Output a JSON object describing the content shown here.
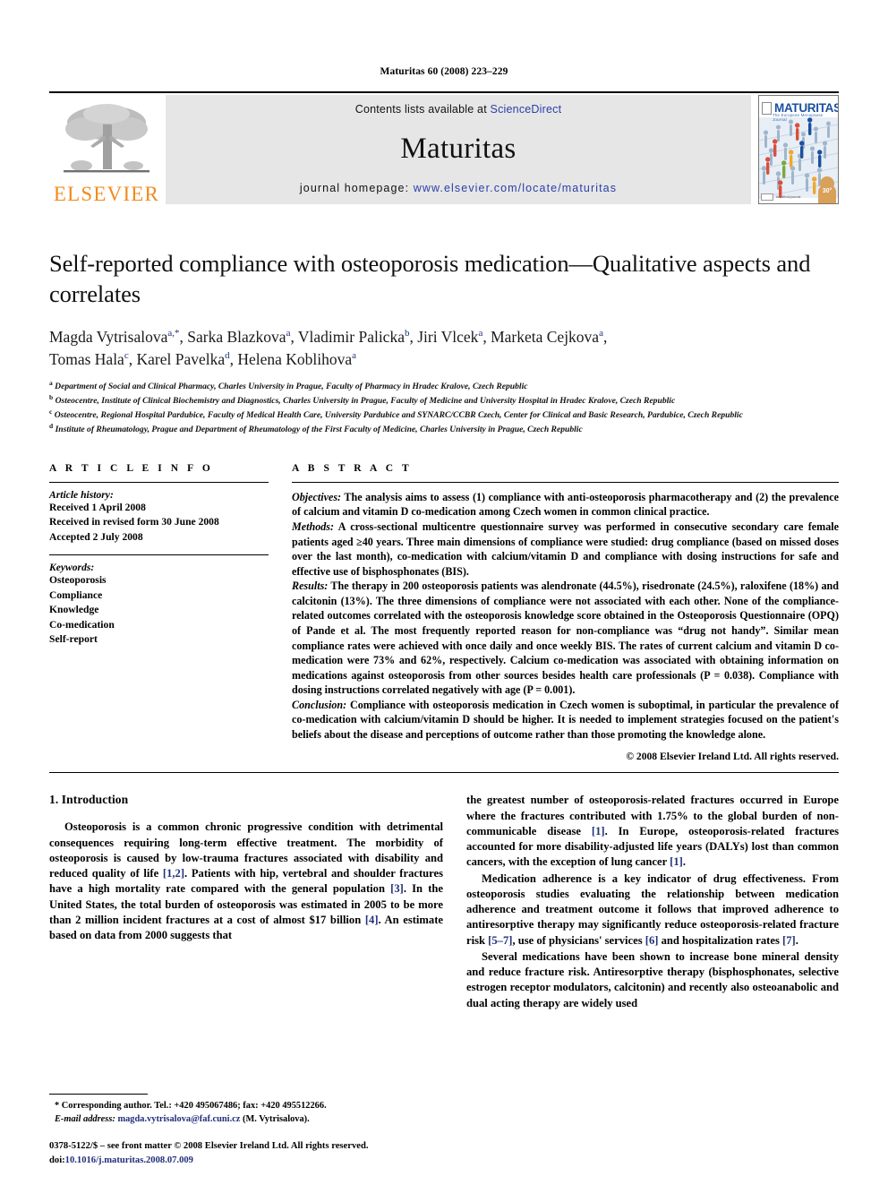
{
  "running_head": "Maturitas 60 (2008) 223–229",
  "banner": {
    "publisher_logo_text": "ELSEVIER",
    "contents_prefix": "Contents lists available at ",
    "contents_link": "ScienceDirect",
    "journal_name": "Maturitas",
    "homepage_prefix": "journal homepage: ",
    "homepage_url": "www.elsevier.com/locate/maturitas",
    "cover": {
      "wordmark": "MATURITAS",
      "subtitle": "The European Menopause Journal",
      "badge": "30°",
      "footer_text": "An official journal"
    },
    "colors": {
      "elsevier_orange": "#F08B1D",
      "link_blue": "#2b40a6",
      "banner_grey": "#e6e6e6"
    }
  },
  "article": {
    "title": "Self-reported compliance with osteoporosis medication—Qualitative aspects and correlates",
    "authors_line1": "Magda Vytrisalova",
    "authors_html": "Magda Vytrisalova<sup>a,*</sup>, Sarka Blazkova<sup>a</sup>, Vladimir Palicka<sup>b</sup>, Jiri Vlcek<sup>a</sup>, Marketa Cejkova<sup>a</sup>, Tomas Hala<sup>c</sup>, Karel Pavelka<sup>d</sup>, Helena Koblihova<sup>a</sup>",
    "affiliations": [
      "Department of Social and Clinical Pharmacy, Charles University in Prague, Faculty of Pharmacy in Hradec Kralove, Czech Republic",
      "Osteocentre, Institute of Clinical Biochemistry and Diagnostics, Charles University in Prague, Faculty of Medicine and University Hospital in Hradec Kralove, Czech Republic",
      "Osteocentre, Regional Hospital Pardubice, Faculty of Medical Health Care, University Pardubice and SYNARC/CCBR Czech, Center for Clinical and Basic Research, Pardubice, Czech Republic",
      "Institute of Rheumatology, Prague and Department of Rheumatology of the First Faculty of Medicine, Charles University in Prague, Czech Republic"
    ],
    "affiliation_markers": [
      "a",
      "b",
      "c",
      "d"
    ]
  },
  "article_info": {
    "heading": "A R T I C L E    I N F O",
    "history_label": "Article history:",
    "history": [
      "Received 1 April 2008",
      "Received in revised form 30 June 2008",
      "Accepted 2 July 2008"
    ],
    "keywords_label": "Keywords:",
    "keywords": [
      "Osteoporosis",
      "Compliance",
      "Knowledge",
      "Co-medication",
      "Self-report"
    ]
  },
  "abstract": {
    "heading": "A B S T R A C T",
    "objectives_label": "Objectives:",
    "objectives_text": " The analysis aims to assess (1) compliance with anti-osteoporosis pharmacotherapy and (2) the prevalence of calcium and vitamin D co-medication among Czech women in common clinical practice.",
    "methods_label": "Methods:",
    "methods_text": " A cross-sectional multicentre questionnaire survey was performed in consecutive secondary care female patients aged ≥40 years. Three main dimensions of compliance were studied: drug compliance (based on missed doses over the last month), co-medication with calcium/vitamin D and compliance with dosing instructions for safe and effective use of bisphosphonates (BIS).",
    "results_label": "Results:",
    "results_text": " The therapy in 200 osteoporosis patients was alendronate (44.5%), risedronate (24.5%), raloxifene (18%) and calcitonin (13%). The three dimensions of compliance were not associated with each other. None of the compliance-related outcomes correlated with the osteoporosis knowledge score obtained in the Osteoporosis Questionnaire (OPQ) of Pande et al. The most frequently reported reason for non-compliance was “drug not handy”. Similar mean compliance rates were achieved with once daily and once weekly BIS. The rates of current calcium and vitamin D co-medication were 73% and 62%, respectively. Calcium co-medication was associated with obtaining information on medications against osteoporosis from other sources besides health care professionals (P = 0.038). Compliance with dosing instructions correlated negatively with age (P = 0.001).",
    "conclusion_label": "Conclusion:",
    "conclusion_text": " Compliance with osteoporosis medication in Czech women is suboptimal, in particular the prevalence of co-medication with calcium/vitamin D should be higher. It is needed to implement strategies focused on the patient's beliefs about the disease and perceptions of outcome rather than those promoting the knowledge alone.",
    "copyright": "© 2008 Elsevier Ireland Ltd. All rights reserved."
  },
  "introduction": {
    "heading": "1.  Introduction",
    "left_para1_a": "Osteoporosis is a common chronic progressive condition with detrimental consequences requiring long-term effective treatment. The morbidity of osteoporosis is caused by low-trauma fractures associated with disability and reduced quality of life ",
    "left_ref_12": "[1,2]",
    "left_para1_b": ". Patients with hip, vertebral and shoulder fractures have a high mortality rate compared with the general population ",
    "left_ref_3": "[3]",
    "left_para1_c": ". In the United States, the total burden of osteoporosis was estimated in 2005 to be more than 2 million incident fractures at a cost of almost $17 billion ",
    "left_ref_4": "[4]",
    "left_para1_d": ". An estimate based on data from 2000 suggests that",
    "right_para1_a": "the greatest number of osteoporosis-related fractures occurred in Europe where the fractures contributed with 1.75% to the global burden of non-communicable disease ",
    "right_ref_1a": "[1]",
    "right_para1_b": ". In Europe, osteoporosis-related fractures accounted for more disability-adjusted life years (DALYs) lost than common cancers, with the exception of lung cancer ",
    "right_ref_1b": "[1]",
    "right_para1_c": ".",
    "right_para2_a": "Medication adherence is a key indicator of drug effectiveness. From osteoporosis studies evaluating the relationship between medication adherence and treatment outcome it follows that improved adherence to antiresorptive therapy may significantly reduce osteoporosis-related fracture risk ",
    "right_ref_57": "[5–7]",
    "right_para2_b": ", use of physicians' services ",
    "right_ref_6": "[6]",
    "right_para2_c": " and hospitalization rates ",
    "right_ref_7": "[7]",
    "right_para2_d": ".",
    "right_para3": "Several medications have been shown to increase bone mineral density and reduce fracture risk. Antiresorptive therapy (bisphosphonates, selective estrogen receptor modulators, calcitonin) and recently also osteoanabolic and dual acting therapy are widely used"
  },
  "footnotes": {
    "corresponding_marker": "*",
    "corresponding_text": " Corresponding author. Tel.: +420 495067486; fax: +420 495512266.",
    "email_label": "E-mail address:",
    "email": "magda.vytrisalova@faf.cuni.cz",
    "email_suffix": " (M. Vytrisalova).",
    "imprint_line1": "0378-5122/$ – see front matter © 2008 Elsevier Ireland Ltd. All rights reserved.",
    "doi_label": "doi:",
    "doi_value": "10.1016/j.maturitas.2008.07.009"
  }
}
